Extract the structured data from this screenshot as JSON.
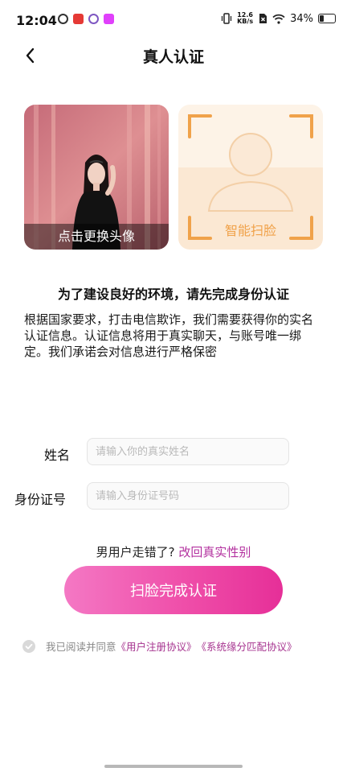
{
  "status_bar": {
    "time": "12:04",
    "net_speed_value": "12.6",
    "net_speed_unit": "KB/s",
    "battery": "34%",
    "battery_level": 0.34
  },
  "nav": {
    "title": "真人认证"
  },
  "avatar": {
    "caption": "点击更换头像"
  },
  "scan": {
    "label": "智能扫脸"
  },
  "intro": {
    "headline": "为了建设良好的环境，请先完成身份认证",
    "description": "根据国家要求，打击电信欺诈，我们需要获得你的实名认证信息。认证信息将用于真实聊天，与账号唯一绑定。我们承诺会对信息进行严格保密"
  },
  "form": {
    "name_label": "姓名",
    "name_placeholder": "请输入你的真实姓名",
    "id_label": "身份证号",
    "id_placeholder": "请输入身份证号码"
  },
  "gender": {
    "prompt": "男用户走错了?",
    "link": "改回真实性别"
  },
  "submit": {
    "label": "扫脸完成认证"
  },
  "agreement": {
    "prefix": "我已阅读并同意",
    "link1": "《用户注册协议》",
    "link2": "《系统缘分匹配协议》"
  },
  "colors": {
    "accent_pink": "#ec4aa6",
    "link_purple": "#b3309f",
    "scan_orange": "#f0a24a"
  }
}
